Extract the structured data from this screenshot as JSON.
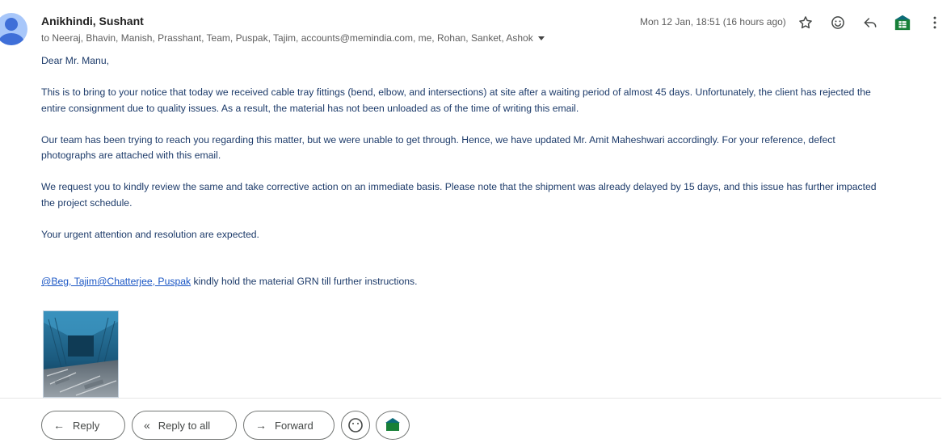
{
  "message": {
    "sender_name": "Anikhindi, Sushant",
    "recipients_line": "to Neeraj, Bhavin, Manish, Prasshant, Team, Puspak, Tajim, accounts@memindia.com, me, Rohan, Sanket, Ashok",
    "timestamp": "Mon 12 Jan, 18:51 (16 hours ago)"
  },
  "body": {
    "greeting": "Dear Mr. Manu,",
    "p1a": "This is to bring to your notice that today we received cable tray fittings (bend, elbow, and intersections) at site after a waiting period of almost 45 days. Unfortunately, the client has rejected the",
    "p1b": "entire consignment due to quality issues. As a result, the material has not been unloaded as of the time of writing this email.",
    "p2a": "Our team has been trying to reach you regarding this matter, but we were unable to get through. Hence, we have updated Mr. Amit Maheshwari accordingly. For your reference, defect",
    "p2b": "photographs are attached with this email.",
    "p3a": "We request you to kindly review the same and take corrective action on an immediate basis. Please note that the shipment was already delayed by 15 days, and this issue has further impacted",
    "p3b": "the project schedule.",
    "p4": "Your urgent attention and resolution are expected.",
    "mention1": "@Beg, Tajim",
    "mention2": "@Chatterjee, Puspak",
    "mention_suffix": " kindly hold the material GRN till further instructions."
  },
  "actions": {
    "reply": "Reply",
    "reply_all": "Reply to all",
    "forward": "Forward"
  },
  "icons": {
    "star": "star-icon",
    "emoji": "emoji-icon",
    "reply": "reply-icon",
    "sheets": "google-sheets-icon",
    "more": "more-vert-icon"
  },
  "colors": {
    "body_text": "#1d3b6a",
    "link": "#1a56c4",
    "avatar_bg": "#a8c7fa",
    "avatar_fg": "#3f6fd8",
    "sheets_green": "#188038"
  }
}
